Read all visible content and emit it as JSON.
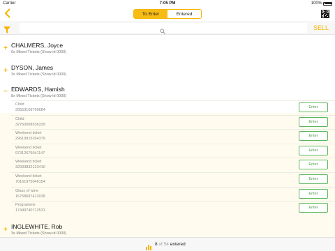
{
  "status_bar": {
    "carrier": "Carrier",
    "time": "7:05 PM",
    "battery": "100%"
  },
  "nav": {
    "segments": [
      {
        "label": "To Enter",
        "active": true
      },
      {
        "label": "Entered",
        "active": false
      }
    ]
  },
  "search": {
    "placeholder": ""
  },
  "sell_label": "SELL",
  "groups": [
    {
      "sign": "+",
      "name": "CHALMERS, Joyce",
      "subtitle": "6x Mixed Tickets (Show id 0000)"
    },
    {
      "sign": "+",
      "name": "DYSON, James",
      "subtitle": "3x Mixed Tickets (Show id 0000)"
    },
    {
      "sign": "−",
      "name": "EDWARDS, Hamish",
      "subtitle": "8x Mixed Tickets (Show id 0000)"
    },
    {
      "sign": "+",
      "name": "INGLEWHITE, Rob",
      "subtitle": "3x Mixed Tickets (Show id 0000)"
    }
  ],
  "tickets": [
    {
      "type": "Child",
      "code": "29553109790684",
      "button": "Enter"
    },
    {
      "type": "Child",
      "code": "32760068536339",
      "button": "Enter"
    },
    {
      "type": "Weekend ticket",
      "code": "29619915264379",
      "button": "Enter"
    },
    {
      "type": "Weekend ticket",
      "code": "97312675041147",
      "button": "Enter"
    },
    {
      "type": "Weekend ticket",
      "code": "32933832123410",
      "button": "Enter"
    },
    {
      "type": "Weekend ticket",
      "code": "70161975046154",
      "button": "Enter"
    },
    {
      "type": "Glass of wine",
      "code": "16758687412038",
      "button": "Enter"
    },
    {
      "type": "Programme",
      "code": "17449740712531",
      "button": "Enter"
    }
  ],
  "footer": {
    "entered_count": "8",
    "of_label": "of",
    "total": "54",
    "suffix": "entered"
  },
  "colors": {
    "accent": "#f5b400",
    "enter_green": "#5cb85c"
  }
}
